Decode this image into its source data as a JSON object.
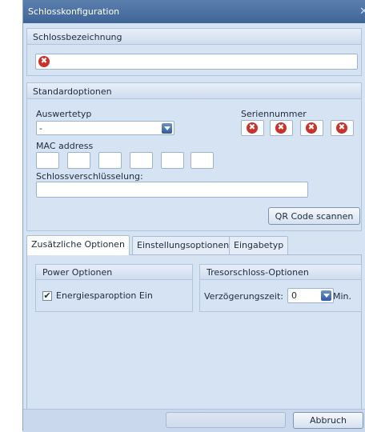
{
  "window": {
    "title": "Schlosskonfiguration",
    "close_glyph": "✕"
  },
  "name_group": {
    "header": "Schlossbezeichnung",
    "error_glyph": "✖"
  },
  "standard": {
    "header": "Standardoptionen",
    "auswertetyp_label": "Auswertetyp",
    "auswertetyp_value": "-",
    "serial_label": "Seriennummer",
    "mac_label": "MAC address",
    "encryption_label": "Schlossverschlüsselung:",
    "qr_button": "QR Code scannen"
  },
  "tabs": [
    {
      "label": "Zusätzliche Optionen"
    },
    {
      "label": "Einstellungsoptionen"
    },
    {
      "label": "Eingabetyp"
    }
  ],
  "power": {
    "header": "Power Optionen",
    "checkbox_label": "Energiesparoption Ein",
    "checked_glyph": "✔"
  },
  "safe": {
    "header": "Tresorschloss-Optionen",
    "delay_label": "Verzögerungszeit:",
    "delay_value": "0",
    "unit": "Min."
  },
  "footer": {
    "cancel_button": "Abbruch"
  },
  "colors": {
    "title_bar": "#4a70a3",
    "background": "#d6e3f3",
    "error": "#c8322c"
  }
}
